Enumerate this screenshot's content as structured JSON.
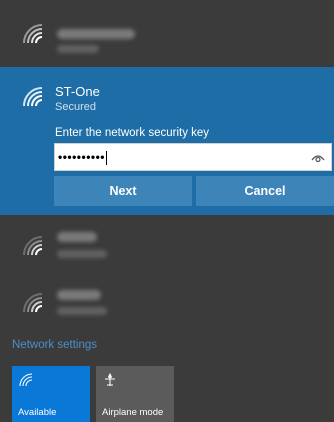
{
  "networks": {
    "top": {
      "icon": "wifi-icon"
    },
    "selected": {
      "ssid": "ST-One",
      "status": "Secured",
      "key_prompt": "Enter the network security key",
      "key_value": "••••••••••",
      "reveal_icon": "eye-icon",
      "next_label": "Next",
      "cancel_label": "Cancel"
    },
    "lower_1": {
      "icon": "wifi-icon"
    },
    "lower_2": {
      "icon": "wifi-icon"
    }
  },
  "links": {
    "network_settings": "Network settings"
  },
  "quick_actions": [
    {
      "label": "Available",
      "icon": "wifi-icon",
      "active": true
    },
    {
      "label": "Airplane mode",
      "icon": "airplane-icon",
      "active": false
    }
  ],
  "colors": {
    "panel_bg": "#3b3b3b",
    "selected_bg": "#1e6da6",
    "button_bg": "#3d84b8",
    "link": "#4c8fc7",
    "tile_active": "#0a78d7",
    "tile_inactive": "#5b5b5b"
  }
}
